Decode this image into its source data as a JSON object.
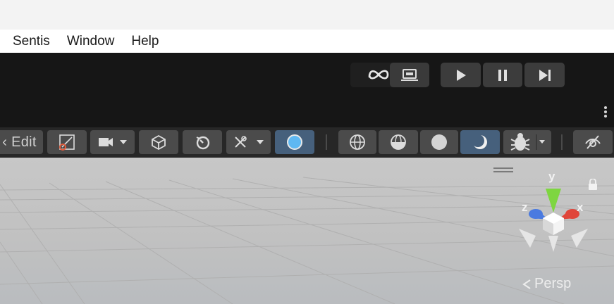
{
  "menubar": {
    "items": [
      {
        "label": "Sentis"
      },
      {
        "label": "Window"
      },
      {
        "label": "Help"
      }
    ]
  },
  "main_toolbar": {
    "meta_icon": "meta-infinity-icon",
    "device_icon": "laptop-icon",
    "play_icon": "play-icon",
    "pause_icon": "pause-icon",
    "step_icon": "step-forward-icon",
    "more_icon": "kebab-menu-icon"
  },
  "scene_toolbar": {
    "edit_label": "‹ Edit",
    "buttons": [
      "draw-mode-icon",
      "camera-icon",
      "cube-icon",
      "gauge-icon",
      "tools-icon",
      "sphere-light-icon",
      "wireframe-sphere-icon",
      "shaded-wireframe-icon",
      "shaded-sphere-icon",
      "unlit-sphere-icon",
      "bug-icon",
      "visibility-icon"
    ],
    "active_button_color": "#46607c"
  },
  "viewport": {
    "gizmo": {
      "axis_y": "y",
      "axis_x": "x",
      "axis_z": "z",
      "colors": {
        "y": "#7ed640",
        "x": "#e0453a",
        "z": "#4a7ae0"
      }
    },
    "projection_label": "Persp",
    "lock_icon": "lock-icon"
  }
}
